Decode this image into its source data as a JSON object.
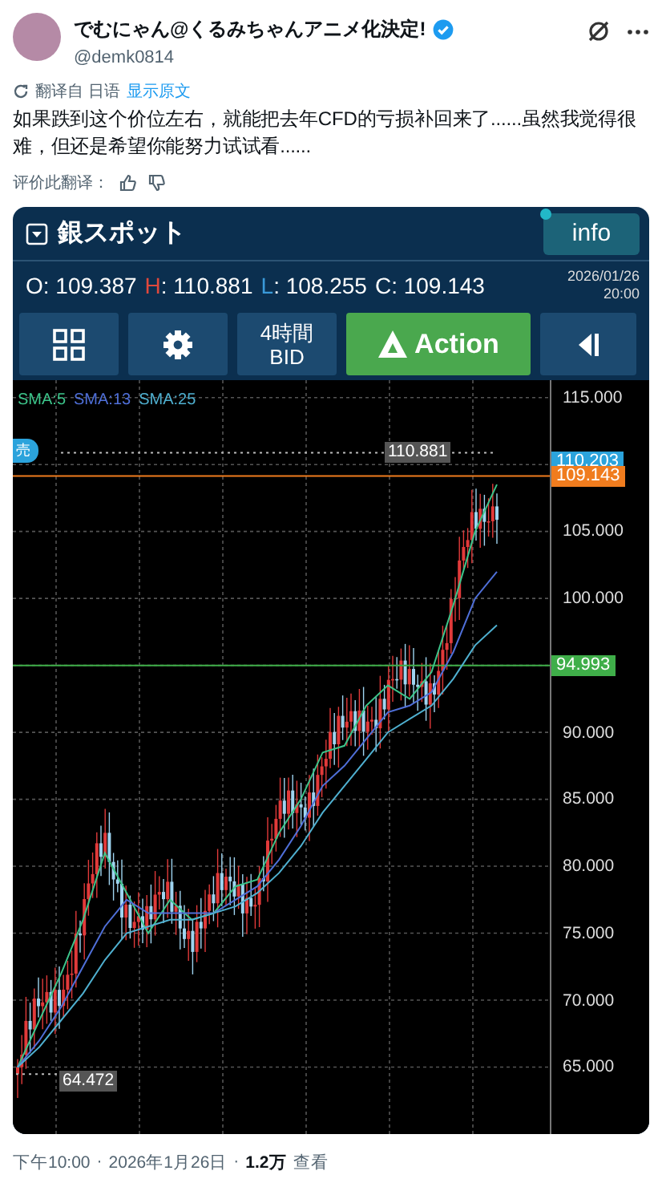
{
  "post": {
    "author": "でむにゃん@くるみちゃんアニメ化決定!",
    "verified": true,
    "handle": "@demk0814",
    "translated_from": "翻译自 日语",
    "show_original": "显示原文",
    "text": "如果跌到这个价位左右，就能把去年CFD的亏损补回来了......虽然我觉得很难，但还是希望你能努力试试看......",
    "rate_label": "评价此翻译："
  },
  "app": {
    "instrument": "銀スポット",
    "info_button": "info",
    "ohlc": [
      {
        "label": "O",
        "value": ": 109.387",
        "color": "#ffffff"
      },
      {
        "label": "H",
        "value": ": 110.881",
        "color": "#e0483c"
      },
      {
        "label": "L",
        "value": ": 108.255",
        "color": "#3a9ad9"
      },
      {
        "label": "C",
        "value": ": 109.143",
        "color": "#ffffff"
      }
    ],
    "date": "2026/01/26",
    "time": "20:00",
    "toolbar": [
      {
        "kind": "grid"
      },
      {
        "kind": "gear"
      },
      {
        "kind": "text",
        "line1": "4時間",
        "line2": "BID"
      },
      {
        "kind": "action",
        "label": "Action"
      },
      {
        "kind": "collapse"
      }
    ]
  },
  "chart": {
    "chart_data": {
      "type": "line",
      "grid": true,
      "ylim": [
        60,
        116.3
      ],
      "yticks": [
        {
          "value": 115,
          "label": "115.000"
        },
        {
          "value": 105,
          "label": "105.000"
        },
        {
          "value": 100,
          "label": "100.000"
        },
        {
          "value": 90,
          "label": "90.000"
        },
        {
          "value": 85,
          "label": "85.000"
        },
        {
          "value": 80,
          "label": "80.000"
        },
        {
          "value": 75,
          "label": "75.000"
        },
        {
          "value": 70,
          "label": "70.000"
        },
        {
          "value": 65,
          "label": "65.000"
        }
      ],
      "series": [
        {
          "name": "SMA:5",
          "color": "#3cc48a",
          "values": [
            65,
            68.5,
            72,
            76,
            81,
            78,
            75,
            77.5,
            76,
            76.5,
            78.5,
            79,
            82.5,
            85,
            88.5,
            89,
            92,
            93.5,
            92.5,
            94.5,
            99.5,
            105,
            108.5
          ]
        },
        {
          "name": "SMA:13",
          "color": "#4f6fd8",
          "values": [
            65,
            67,
            69.5,
            72.5,
            75.5,
            77.5,
            76.5,
            76.5,
            76.5,
            76.5,
            77.5,
            78.5,
            80.5,
            83,
            86,
            87.5,
            89.5,
            91.5,
            92,
            93,
            96,
            100,
            102
          ]
        },
        {
          "name": "SMA:25",
          "color": "#4fb0d0",
          "values": [
            65,
            66.5,
            68.5,
            70.5,
            73,
            75,
            75.5,
            76,
            76,
            76.5,
            77,
            78,
            79.5,
            81.5,
            84,
            86,
            88,
            90,
            91,
            92,
            94,
            96.5,
            98
          ]
        }
      ]
    },
    "sell_tag": "売",
    "high_label": "110.881",
    "low_label": "64.472",
    "price_tags": [
      {
        "text": "110.203",
        "color": "#2ba3dc"
      },
      {
        "text": "109.143",
        "color": "#f07c1e"
      },
      {
        "text": "94.993",
        "color": "#3fae49"
      }
    ]
  },
  "footer": {
    "time": "下午10:00",
    "separators": [
      "·",
      "·"
    ],
    "date": "2026年1月26日",
    "views": "1.2万",
    "views_label": "查看"
  }
}
